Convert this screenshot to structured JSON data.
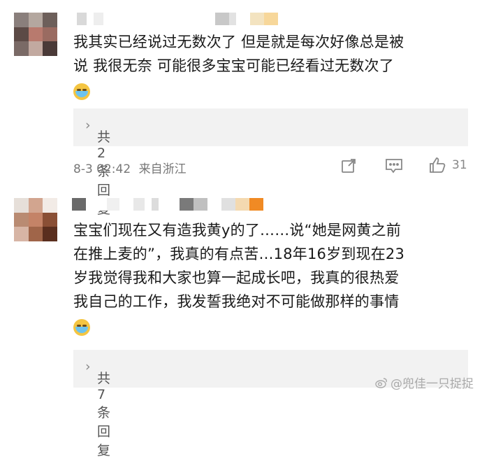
{
  "comments": [
    {
      "text_line1": "我其实已经说过无数次了 但是就是每次好像总是被",
      "text_line2": "说 我很无奈 可能很多宝宝可能已经看过无数次了",
      "emoji": "crying-face",
      "replies_label": "共2条回复",
      "timestamp": "8-3 02:42",
      "location": "来自浙江",
      "like_count": "31"
    },
    {
      "text_line1": "宝宝们现在又有造我黄y的了……说“她是网黄之前",
      "text_line2": "在推上麦的”，我真的有点苦…18年16岁到现在23",
      "text_line3": "岁我觉得我和大家也算一起成长吧，我真的很热爱",
      "text_line4": "我自己的工作，我发誓我绝对不可能做那样的事情",
      "emoji": "crying-face",
      "replies_label": "共7条回复"
    }
  ],
  "watermark": "@兜佳一只捉捉",
  "icons": {
    "share": "share-icon",
    "comment": "comment-icon",
    "like": "thumbs-up-icon",
    "chevron": "chevron-right-icon",
    "weibo": "weibo-logo-icon"
  },
  "colors": {
    "reply_box_bg": "#f2f2f2",
    "meta_text": "#777777",
    "body_text": "#1a1a1a"
  }
}
